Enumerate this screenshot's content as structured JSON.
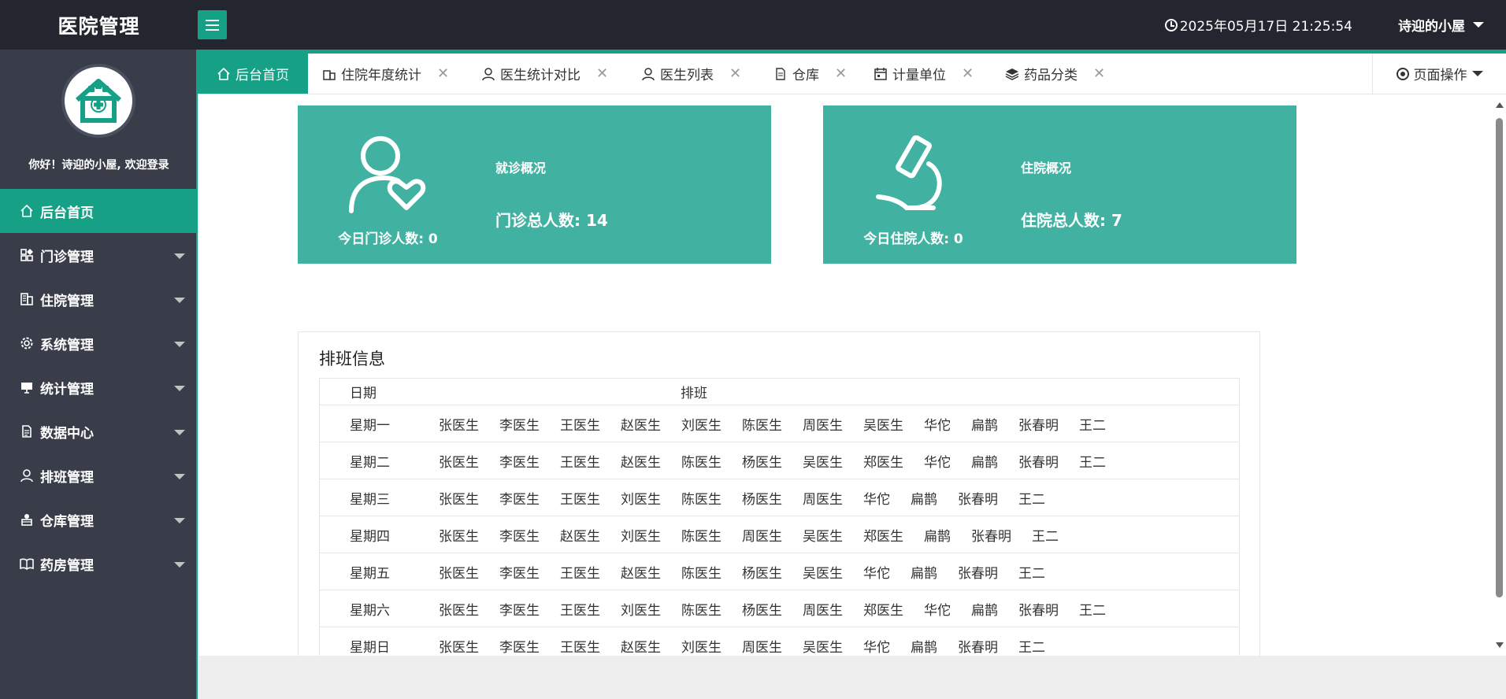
{
  "header": {
    "app_title": "医院管理",
    "datetime": "2025年05月17日 21:25:54",
    "username": "诗迎的小屋"
  },
  "sidebar": {
    "welcome": "你好！诗迎的小屋, 欢迎登录",
    "items": [
      {
        "label": "后台首页",
        "icon": "home-icon",
        "active": true
      },
      {
        "label": "门诊管理",
        "icon": "apps-icon"
      },
      {
        "label": "住院管理",
        "icon": "building-icon"
      },
      {
        "label": "系统管理",
        "icon": "gear-icon"
      },
      {
        "label": "统计管理",
        "icon": "chart-board-icon"
      },
      {
        "label": "数据中心",
        "icon": "document-icon"
      },
      {
        "label": "排班管理",
        "icon": "user-icon"
      },
      {
        "label": "仓库管理",
        "icon": "warehouse-icon"
      },
      {
        "label": "药房管理",
        "icon": "book-icon"
      }
    ]
  },
  "tabs": [
    {
      "label": "后台首页",
      "icon": "home-icon",
      "active": true
    },
    {
      "label": "住院年度统计",
      "icon": "building-icon"
    },
    {
      "label": "医生统计对比",
      "icon": "user-icon"
    },
    {
      "label": "医生列表",
      "icon": "user-icon"
    },
    {
      "label": "仓库",
      "icon": "document-icon"
    },
    {
      "label": "计量单位",
      "icon": "calendar-icon"
    },
    {
      "label": "药品分类",
      "icon": "layers-icon"
    }
  ],
  "tab_close_glyph": "✕",
  "page_ops_label": "页面操作",
  "cards": {
    "outpatient": {
      "title": "就诊概况",
      "today": "今日门诊人数: 0",
      "total": "门诊总人数: 14"
    },
    "inpatient": {
      "title": "住院概况",
      "today": "今日住院人数: 0",
      "total": "住院总人数: 7"
    }
  },
  "schedule": {
    "title": "排班信息",
    "col_day": "日期",
    "col_shift": "排班",
    "rows": [
      {
        "day": "星期一",
        "doctors": [
          "张医生",
          "李医生",
          "王医生",
          "赵医生",
          "刘医生",
          "陈医生",
          "周医生",
          "吴医生",
          "华佗",
          "扁鹊",
          "张春明",
          "王二"
        ]
      },
      {
        "day": "星期二",
        "doctors": [
          "张医生",
          "李医生",
          "王医生",
          "赵医生",
          "陈医生",
          "杨医生",
          "吴医生",
          "郑医生",
          "华佗",
          "扁鹊",
          "张春明",
          "王二"
        ]
      },
      {
        "day": "星期三",
        "doctors": [
          "张医生",
          "李医生",
          "王医生",
          "刘医生",
          "陈医生",
          "杨医生",
          "周医生",
          "华佗",
          "扁鹊",
          "张春明",
          "王二"
        ]
      },
      {
        "day": "星期四",
        "doctors": [
          "张医生",
          "李医生",
          "赵医生",
          "刘医生",
          "陈医生",
          "周医生",
          "吴医生",
          "郑医生",
          "扁鹊",
          "张春明",
          "王二"
        ]
      },
      {
        "day": "星期五",
        "doctors": [
          "张医生",
          "李医生",
          "王医生",
          "赵医生",
          "陈医生",
          "杨医生",
          "吴医生",
          "华佗",
          "扁鹊",
          "张春明",
          "王二"
        ]
      },
      {
        "day": "星期六",
        "doctors": [
          "张医生",
          "李医生",
          "王医生",
          "刘医生",
          "陈医生",
          "杨医生",
          "周医生",
          "郑医生",
          "华佗",
          "扁鹊",
          "张春明",
          "王二"
        ]
      },
      {
        "day": "星期日",
        "doctors": [
          "张医生",
          "李医生",
          "王医生",
          "赵医生",
          "刘医生",
          "周医生",
          "吴医生",
          "华佗",
          "扁鹊",
          "张春明",
          "王二"
        ]
      }
    ]
  },
  "colors": {
    "accent": "#16a085",
    "card": "#41b2a2",
    "header_bg": "#23262e",
    "sidebar_bg": "#393d49"
  }
}
